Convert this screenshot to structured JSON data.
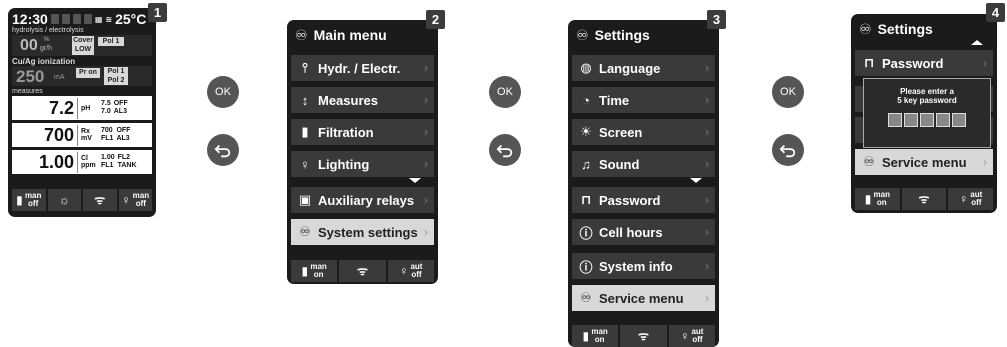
{
  "step_numbers": [
    "1",
    "2",
    "3",
    "4"
  ],
  "nav_buttons": {
    "ok_label": "OK",
    "back_icon": "back-arrow-icon"
  },
  "screen1": {
    "time": "12:30",
    "day_boxes": [
      "1",
      "2",
      "3",
      "4"
    ],
    "temperature": "25°C",
    "hydrolysis_label": "hydrolysis / electrolysis",
    "hydrolysis_value": "00",
    "hydrolysis_unit_top": "%",
    "hydrolysis_unit": "gr/h",
    "cover_label": "Cover",
    "cover_value": "LOW",
    "pol1": "Pol 1",
    "cuag_label": "Cu/Ag ionization",
    "cuag_value": "250",
    "cuag_unit": "mA",
    "pr_on": "Pr on",
    "pol1b": "Pol 1",
    "pol2": "Pol 2",
    "measures_label": "measures",
    "measures": [
      {
        "value": "7.2",
        "unit_top": "pH",
        "unit_bottom": "",
        "set1": "7.5",
        "state1": "OFF",
        "set2": "7.0",
        "state2": "AL3"
      },
      {
        "value": "700",
        "unit_top": "Rx",
        "unit_bottom": "mV",
        "set1": "700",
        "state1": "OFF",
        "set2": "FL1",
        "state2": "AL3"
      },
      {
        "value": "1.00",
        "unit_top": "Cl",
        "unit_bottom": "ppm",
        "set1": "1.00",
        "state1": "FL2",
        "set2": "FL1",
        "state2": "TANK"
      }
    ],
    "footer": [
      {
        "top": "man",
        "bottom": "off"
      },
      {
        "top": "",
        "bottom": ""
      },
      {
        "top": "",
        "bottom": ""
      },
      {
        "top": "man",
        "bottom": "off"
      }
    ]
  },
  "screen2": {
    "title": "Main menu",
    "items": [
      {
        "label": "Hydr. / Electr.",
        "icon": "hydrolysis-icon"
      },
      {
        "label": "Measures",
        "icon": "measures-icon"
      },
      {
        "label": "Filtration",
        "icon": "pump-icon"
      },
      {
        "label": "Lighting",
        "icon": "bulb-icon"
      },
      {
        "label": "Auxiliary relays",
        "icon": "relay-icon"
      },
      {
        "label": "System settings",
        "icon": "settings-icon",
        "selected": true
      }
    ],
    "footer": [
      {
        "top": "man",
        "bottom": "on"
      },
      {
        "top": "",
        "bottom": ""
      },
      {
        "top": "",
        "bottom": ""
      },
      {
        "top": "aut",
        "bottom": "off"
      }
    ]
  },
  "screen3": {
    "title": "Settings",
    "items": [
      {
        "label": "Language",
        "icon": "globe-icon"
      },
      {
        "label": "Time",
        "icon": "clock-icon"
      },
      {
        "label": "Screen",
        "icon": "brightness-icon"
      },
      {
        "label": "Sound",
        "icon": "speaker-icon"
      },
      {
        "label": "Password",
        "icon": "lock-icon"
      },
      {
        "label": "Cell hours",
        "icon": "info-icon"
      },
      {
        "label": "System info",
        "icon": "info-icon"
      },
      {
        "label": "Service menu",
        "icon": "settings-icon",
        "selected": true
      }
    ],
    "footer": [
      {
        "top": "man",
        "bottom": "on"
      },
      {
        "top": "",
        "bottom": ""
      },
      {
        "top": "",
        "bottom": ""
      },
      {
        "top": "aut",
        "bottom": "off"
      }
    ]
  },
  "screen4": {
    "title": "Settings",
    "password_label": "Password",
    "popup_line1": "Please enter a",
    "popup_line2": "5 key password",
    "service_label": "Service menu",
    "footer": [
      {
        "top": "man",
        "bottom": "on"
      },
      {
        "top": "",
        "bottom": ""
      },
      {
        "top": "",
        "bottom": ""
      },
      {
        "top": "aut",
        "bottom": "off"
      }
    ]
  }
}
